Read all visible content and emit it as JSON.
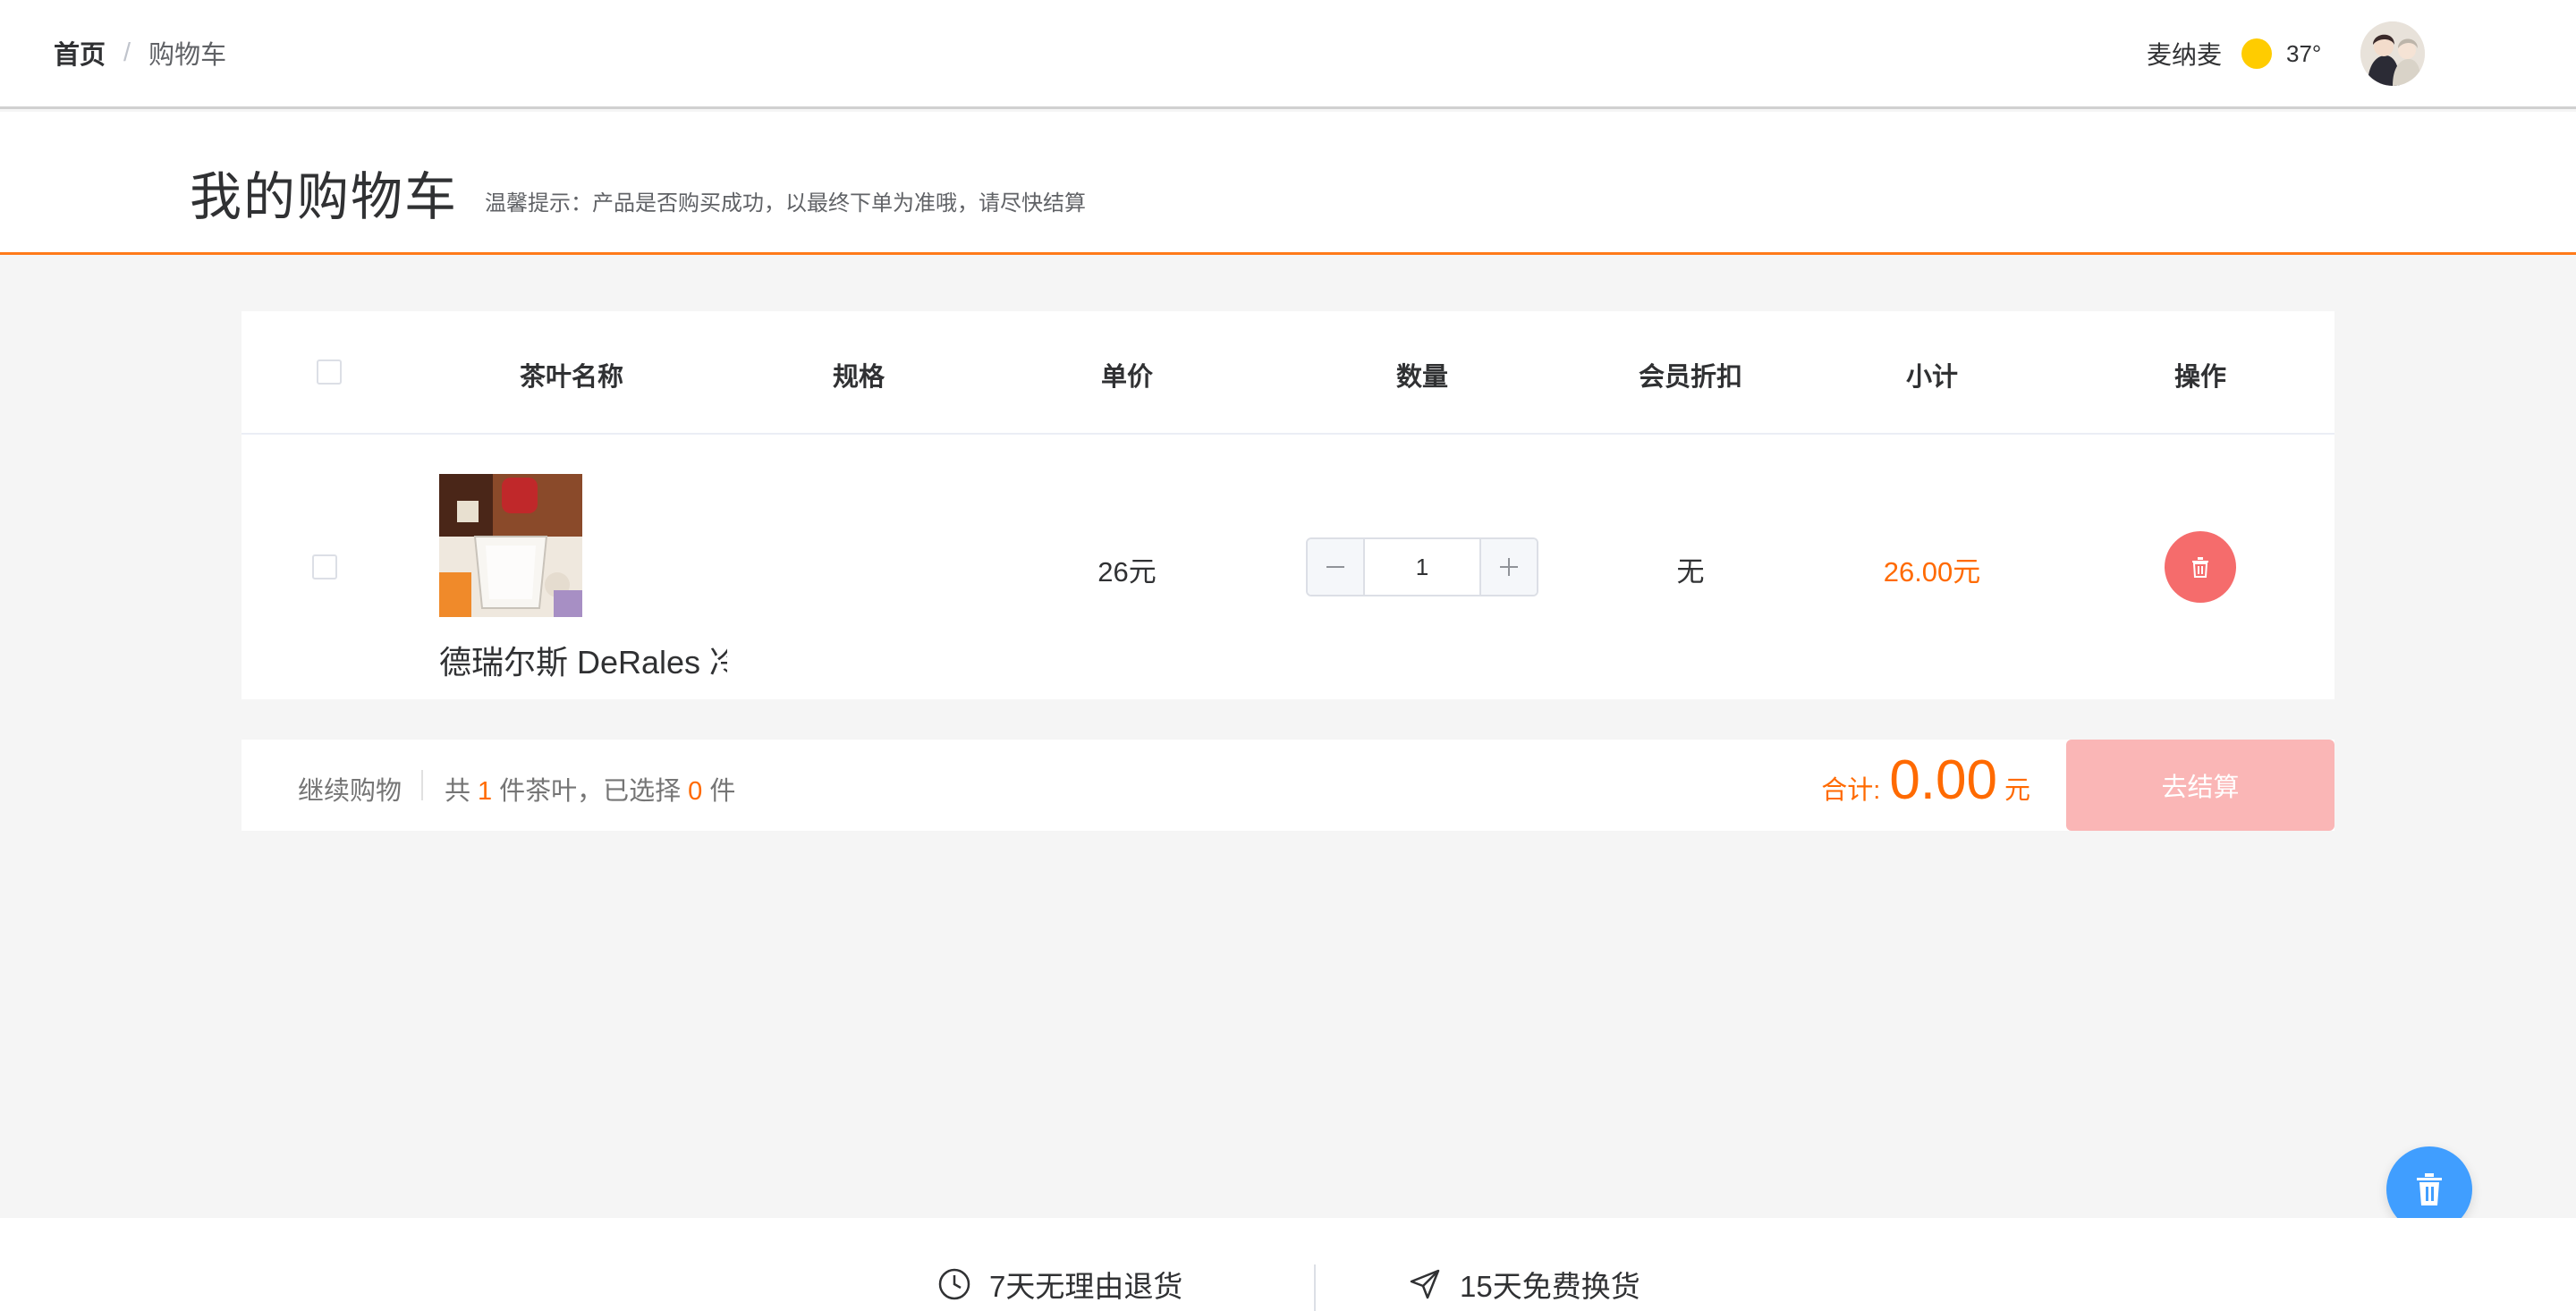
{
  "breadcrumb": {
    "home": "首页",
    "separator": "/",
    "current": "购物车"
  },
  "user": {
    "name": "麦纳麦",
    "weather_icon": "sun-icon",
    "temperature": "37°"
  },
  "page": {
    "title": "我的购物车",
    "tip": "温馨提示：产品是否购买成功，以最终下单为准哦，请尽快结算"
  },
  "table": {
    "headers": [
      "茶叶名称",
      "规格",
      "单价",
      "数量",
      "会员折扣",
      "小计",
      "操作"
    ],
    "rows": [
      {
        "checked": false,
        "name": "德瑞尔斯 DeRales 冷",
        "spec": "",
        "price": "26元",
        "quantity": "1",
        "discount": "无",
        "subtotal": "26.00元",
        "action_icon": "trash-icon"
      }
    ]
  },
  "footer": {
    "continue": "继续购物",
    "count_prefix": "共",
    "total_count": "1",
    "count_middle": "件茶叶，已选择",
    "selected_count": "0",
    "count_suffix": "件",
    "total_label": "合计:",
    "total_amount": "0.00",
    "total_unit": "元",
    "checkout": "去结算"
  },
  "service": [
    {
      "icon": "clock-icon",
      "label": "7天无理由退货"
    },
    {
      "icon": "send-icon",
      "label": "15天免费换货"
    }
  ],
  "colors": {
    "accent": "#ff6a00",
    "delete": "#f56c6c",
    "checkout_disabled": "#fab6b6",
    "float_button": "#409eff"
  }
}
